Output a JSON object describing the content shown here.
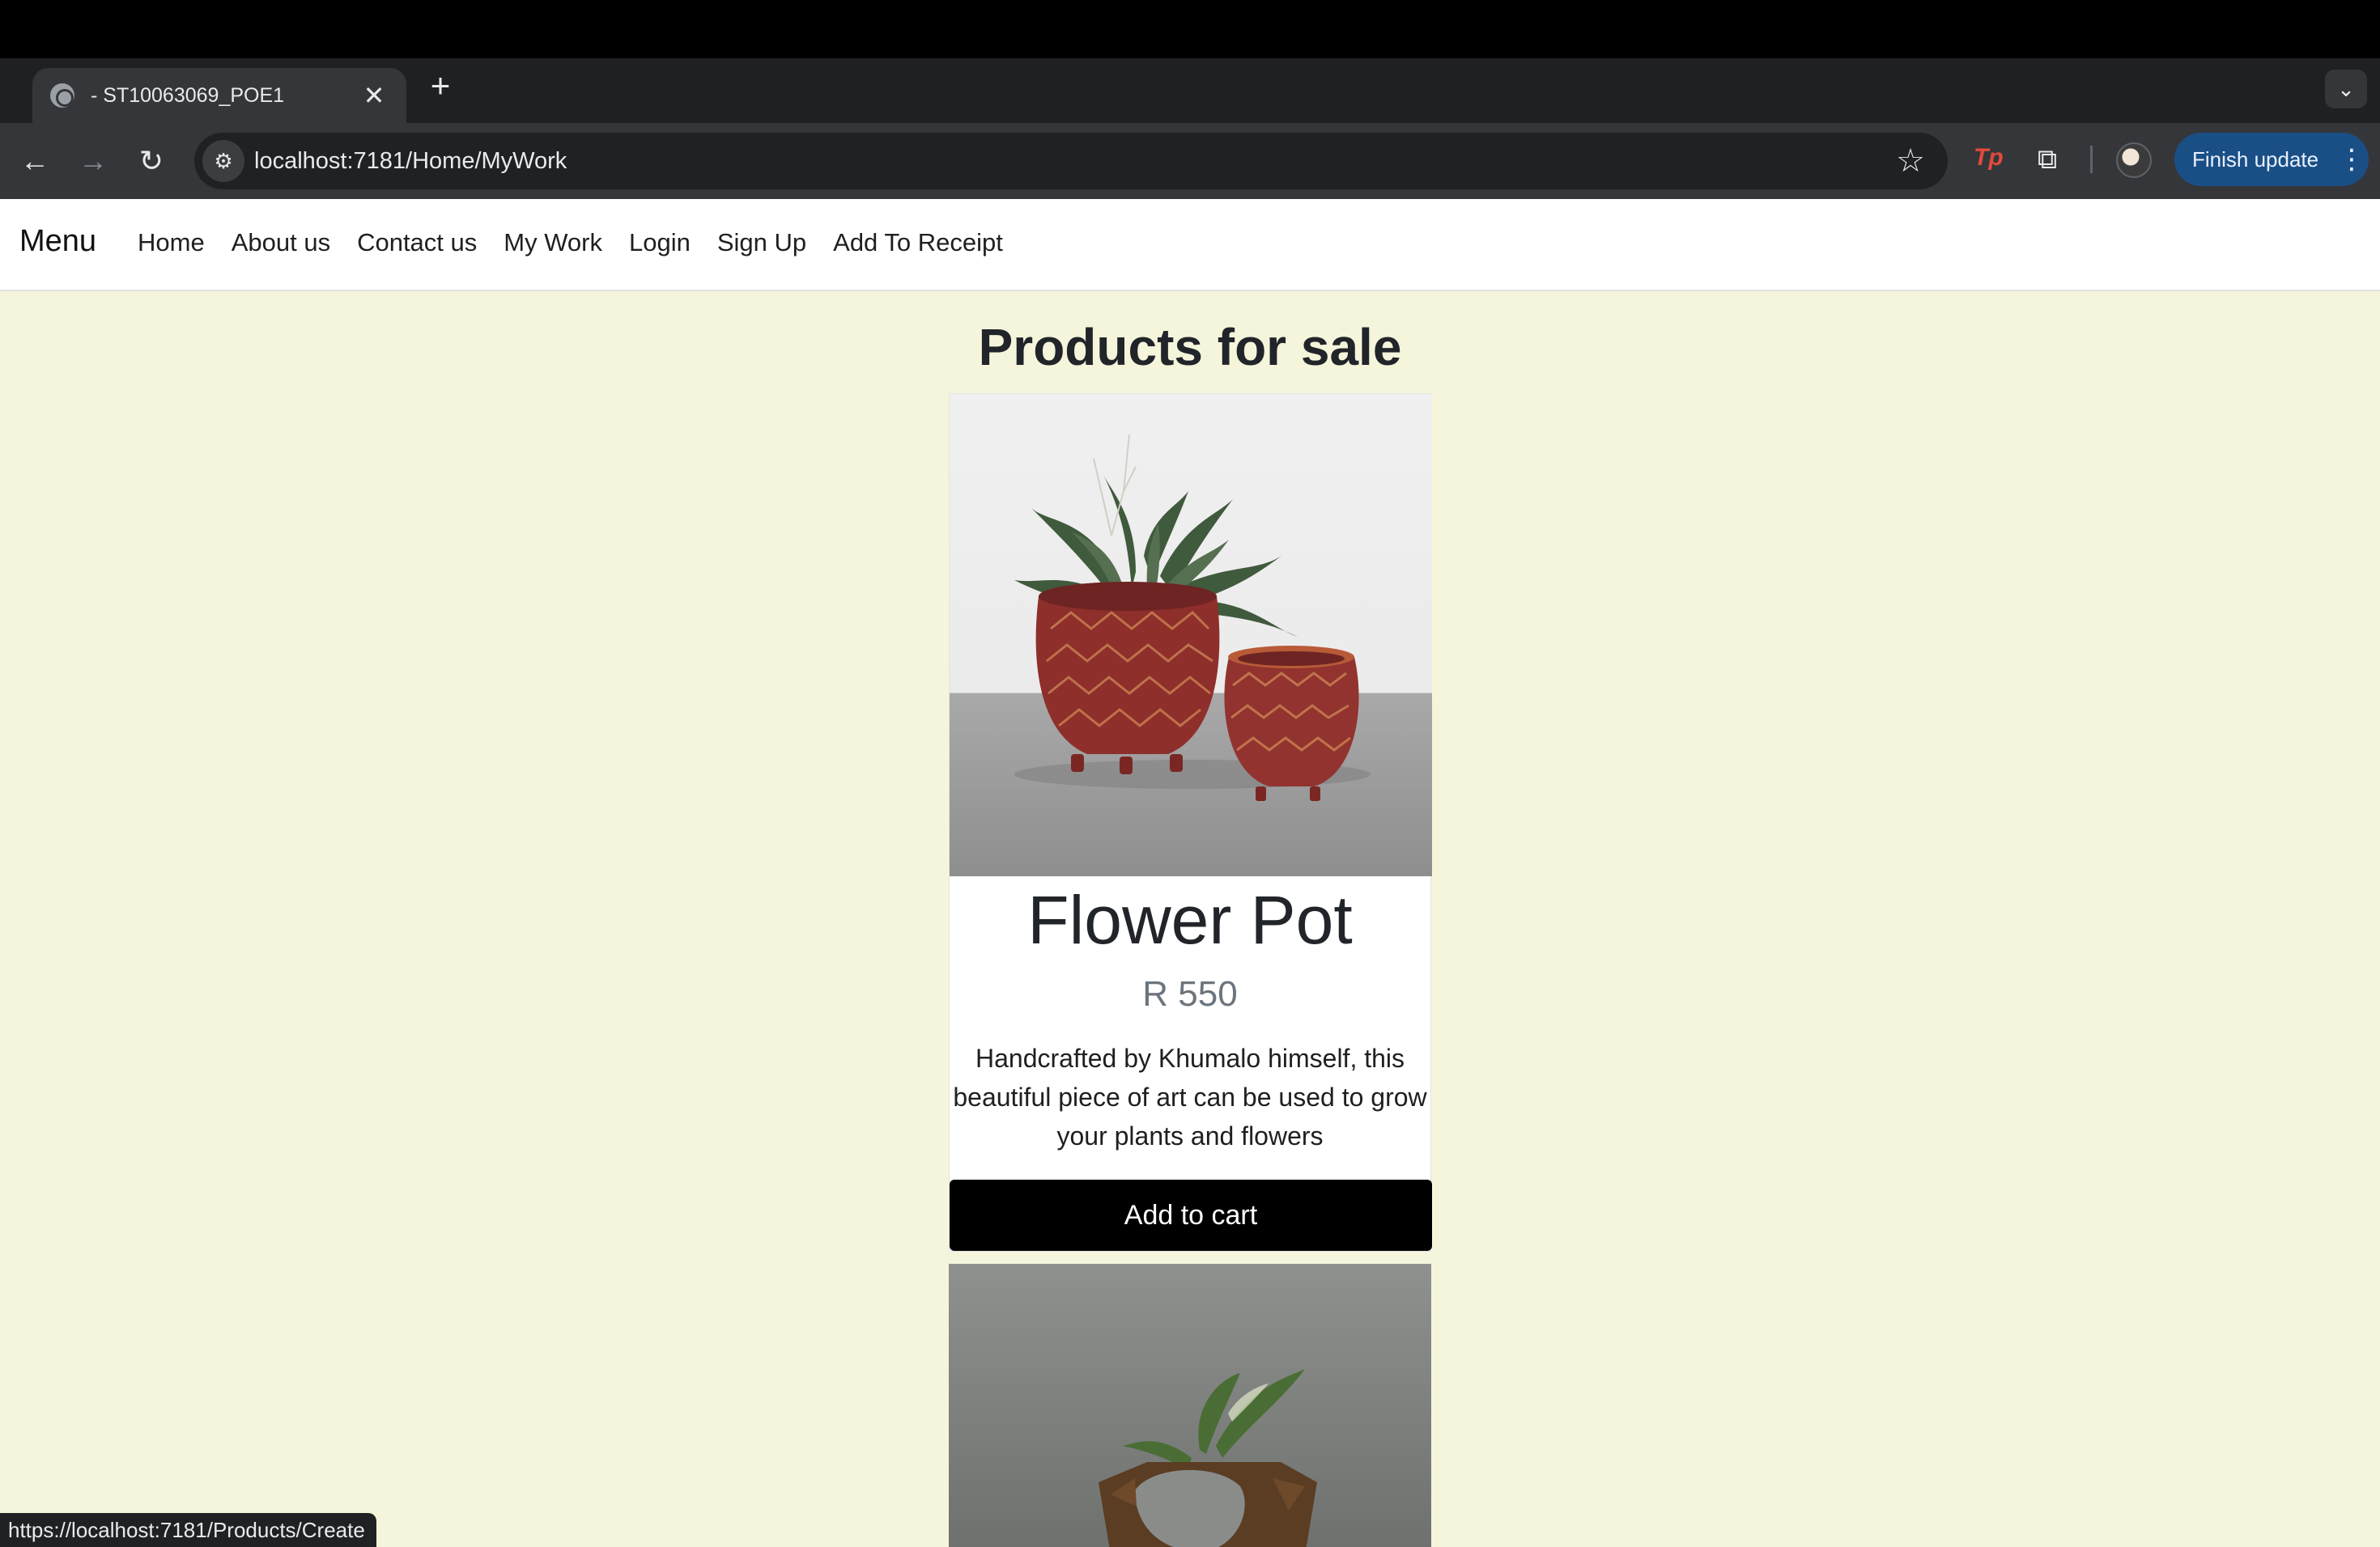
{
  "browser": {
    "tab_title": "- ST10063069_POE1",
    "tab_close": "✕",
    "new_tab": "+",
    "url": "localhost:7181/Home/MyWork",
    "finish_update": "Finish update",
    "status_url": "https://localhost:7181/Products/Create",
    "extension_label": "Tp"
  },
  "nav": {
    "brand": "Menu",
    "links": [
      "Home",
      "About us",
      "Contact us",
      "My Work",
      "Login",
      "Sign Up",
      "Add To Receipt"
    ]
  },
  "main": {
    "title": "Products for sale",
    "products": [
      {
        "name": "Flower Pot",
        "price": "R 550",
        "description": "Handcrafted by Khumalo himself, this beautiful piece of art can be used to grow your plants and flowers",
        "button": "Add to cart"
      }
    ]
  },
  "colors": {
    "page_background": "#f5f5dc",
    "button_background": "#000000",
    "price_text": "#6c757d",
    "update_button": "#1a4f86"
  }
}
